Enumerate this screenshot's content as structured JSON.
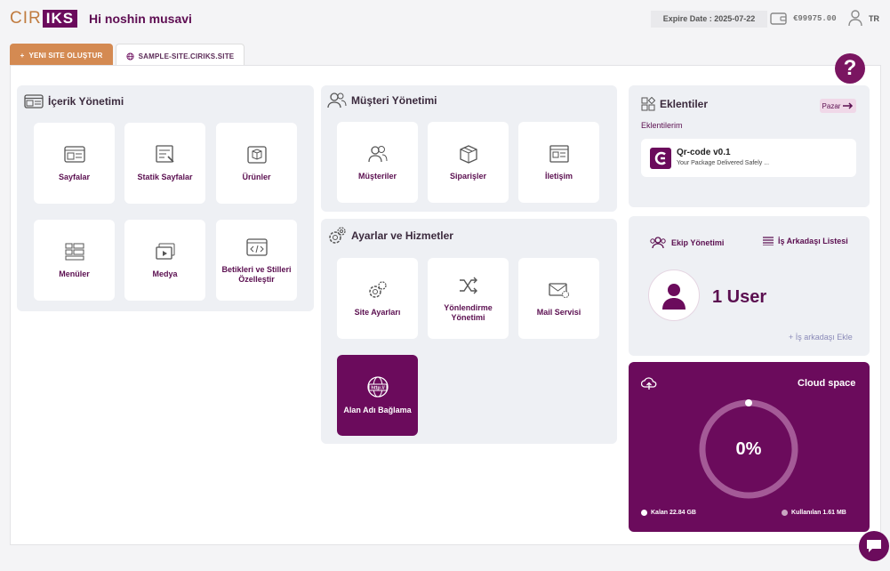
{
  "header": {
    "logo_left": "CIR",
    "logo_right": "IKS",
    "greeting": "Hi noshin musavi",
    "expire": "Expire Date : 2025-07-22",
    "balance": "€99975.00",
    "lang": "TR"
  },
  "tabs": {
    "new_site": "YENI SITE OLUŞTUR",
    "site": "SAMPLE-SITE.CIRIKS.SITE"
  },
  "help_label": "?",
  "content_panel": {
    "title": "İçerik Yönetimi",
    "cards": [
      "Sayfalar",
      "Statik Sayfalar",
      "Ürünler",
      "Menüler",
      "Medya",
      "Betikleri ve Stilleri Özelleştir"
    ]
  },
  "customer_panel": {
    "title": "Müşteri Yönetimi",
    "cards": [
      "Müşteriler",
      "Siparişler",
      "İletişim"
    ]
  },
  "settings_panel": {
    "title": "Ayarlar ve Hizmetler",
    "cards": [
      "Site Ayarları",
      "Yönlendirme Yönetimi",
      "Mail Servisi",
      "Alan Adı Bağlama"
    ]
  },
  "plugins": {
    "title": "Eklentiler",
    "market": "Pazar",
    "my_plugins": "Eklentilerim",
    "item_name": "Qr-code v0.1",
    "item_desc": "Your Package Delivered Safely ..."
  },
  "team": {
    "manage": "Ekip Yönetimi",
    "list": "İş Arkadaşı Listesi",
    "user_count": "1 User",
    "add": "+ İş arkadaşı Ekle"
  },
  "cloud": {
    "title": "Cloud space",
    "percent": "0%",
    "remaining": "Kalan 22.84 GB",
    "used": "Kullanılan 1.61 MB",
    "used_fraction": 0
  },
  "colors": {
    "brand": "#6b0b5c",
    "accent_orange": "#d48a52",
    "panel_bg": "#eef0f4"
  }
}
